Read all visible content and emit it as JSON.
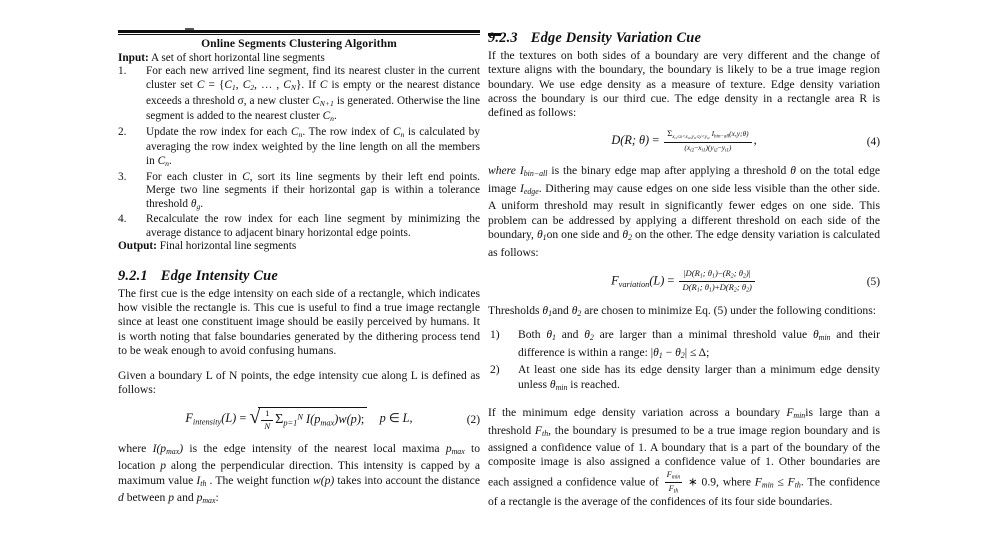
{
  "document": {
    "left_column": {
      "algorithm": {
        "title": "Online Segments Clustering Algorithm",
        "input_label": "Input:",
        "input_text": " A set of short horizontal line segments",
        "steps": [
          {
            "num": "1.",
            "text": "For each new arrived line segment, find its nearest cluster in the current cluster set C = {C₁, C₂, … , Cₙ}. If C is empty or the nearest distance exceeds a threshold σ, a new cluster Cₙ₊₁ is generated. Otherwise the line segment is added to the nearest cluster Cₙ."
          },
          {
            "num": "2.",
            "text": "Update the row index for each Cₙ. The row index of Cₙ is calculated by averaging the row index weighted by the line length on all the members in Cₙ."
          },
          {
            "num": "3.",
            "text": "For each cluster in C, sort its line segments by their left end points. Merge two line segments if their horizontal gap is within a tolerance threshold θ₉."
          },
          {
            "num": "4.",
            "text": "Recalculate the row index for each line segment by minimizing the average distance to adjacent binary horizontal edge points."
          }
        ],
        "output_label": "Output:",
        "output_text": " Final horizontal line segments"
      },
      "section": {
        "number": "9.2.1",
        "title": "Edge Intensity Cue"
      },
      "paragraph_1": "The first cue is the edge intensity on each side of a rectangle, which indicates how visible the rectangle is. This cue is useful to find a true image rectangle since at least one constituent image should be easily perceived by humans. It is worth noting that false boundaries generated by the dithering process tend to be weak enough to avoid confusing humans.",
      "paragraph_2": "Given a boundary L of N points, the edge intensity cue along L is defined as follows:",
      "equation_2": {
        "number": "(2)",
        "lhs": "F",
        "lhs_sub": "intensity",
        "lhs_arg": "(L) =",
        "frac_top": "1",
        "frac_bot": "N",
        "sum": "Σ",
        "sum_sub": "p=1",
        "sum_sup": "N",
        "terms": "I(p",
        "terms_sub": "max",
        "terms_rest": ")w(p);",
        "condition": "p ∈ L,"
      },
      "paragraph_3_parts": {
        "a": "where I(p",
        "a_sub": "max",
        "b": ") is the edge intensity of the nearest local maxima p",
        "b_sub": "max",
        "c": " to location p along the perpendicular direction. This intensity is capped by a maximum value I",
        "c_sub": "th",
        "d": ". The weight function w(p) takes into account the distance d between p and p",
        "d_sub": "max",
        "e": ":"
      }
    },
    "right_column": {
      "section": {
        "number": "9.2.3",
        "title": "Edge Density Variation Cue"
      },
      "paragraph_1": "If the textures on both sides of a boundary are very different and the change of texture aligns with the boundary, the boundary is likely to be a true image region boundary. We use edge density as a measure of texture. Edge density variation across the boundary is our third cue. The edge density in a rectangle area R is defined as follows:",
      "equation_4": {
        "number": "(4)",
        "lhs": "D(R; θ) =",
        "num_sum": "Σ",
        "num_sum_sub": "xᵢ₁≤x<xᵢ₂,yᵢ₁≤y<yᵢ₂",
        "num_term": "I",
        "num_term_sub": "bin−all",
        "num_args": "(x,y;θ)",
        "den": "(xᵢ₂−xᵢ₁)(yᵢ₂−yᵢ₁)",
        "trailer": ","
      },
      "paragraph_2_parts": {
        "a": "where I",
        "a_sub": "bin−all",
        "b": " is the binary edge map after applying a threshold θ on the total edge image I",
        "b_sub": "edge",
        "c": ". Dithering may cause edges on one side less visible than the other side. A uniform threshold may result in significantly fewer edges on one side. This problem can be addressed by applying a different threshold on each side of the boundary, θ",
        "c_sub": "1",
        "d": "on one side and θ",
        "d_sub": "2",
        "e": " on the other. The edge density variation is calculated as follows:"
      },
      "equation_5": {
        "number": "(5)",
        "lhs": "F",
        "lhs_sub": "variation",
        "lhs_arg": "(L) =",
        "frac_top": "|D(R₁; θ₁)−(R₂; θ₂)|",
        "frac_bot": "D(R₁; θ₁)+D(R₂; θ₂)"
      },
      "paragraph_3": "Thresholds θ₁and θ₂ are chosen to minimize Eq. (5) under the following conditions:",
      "conditions": [
        {
          "num": "1)",
          "text": "Both θ₁ and θ₂ are larger than a minimal threshold value θₘᵢₙ and their difference is within a range: |θ₁ − θ₂| ≤ Δ;"
        },
        {
          "num": "2)",
          "text": "At least one side has its edge density larger than a minimum edge density unless θₘᵢₙ is reached."
        }
      ],
      "paragraph_4_parts": {
        "a": "If the minimum edge density variation across a boundary F",
        "a_sub": "min",
        "b": "is large than a threshold F",
        "b_sub": "th",
        "c": ", the boundary is presumed to be a true image region boundary and is assigned a confidence value of 1. A boundary that is a part of the boundary of the composite image is also assigned a confidence value of 1. Other boundaries are each assigned a confidence value of ",
        "frac_top": "F",
        "frac_top_sub": "min",
        "frac_bot": "F",
        "frac_bot_sub": "th",
        "d": " ∗ 0.9, where F",
        "d_sub": "min",
        "e": " ≤ F",
        "e_sub": "th",
        "f": ". The confidence of a rectangle is the average of the confidences of its four side boundaries."
      }
    }
  },
  "colors": {
    "text": "#111111",
    "rule": "#111111",
    "page_background": "#ffffff"
  }
}
